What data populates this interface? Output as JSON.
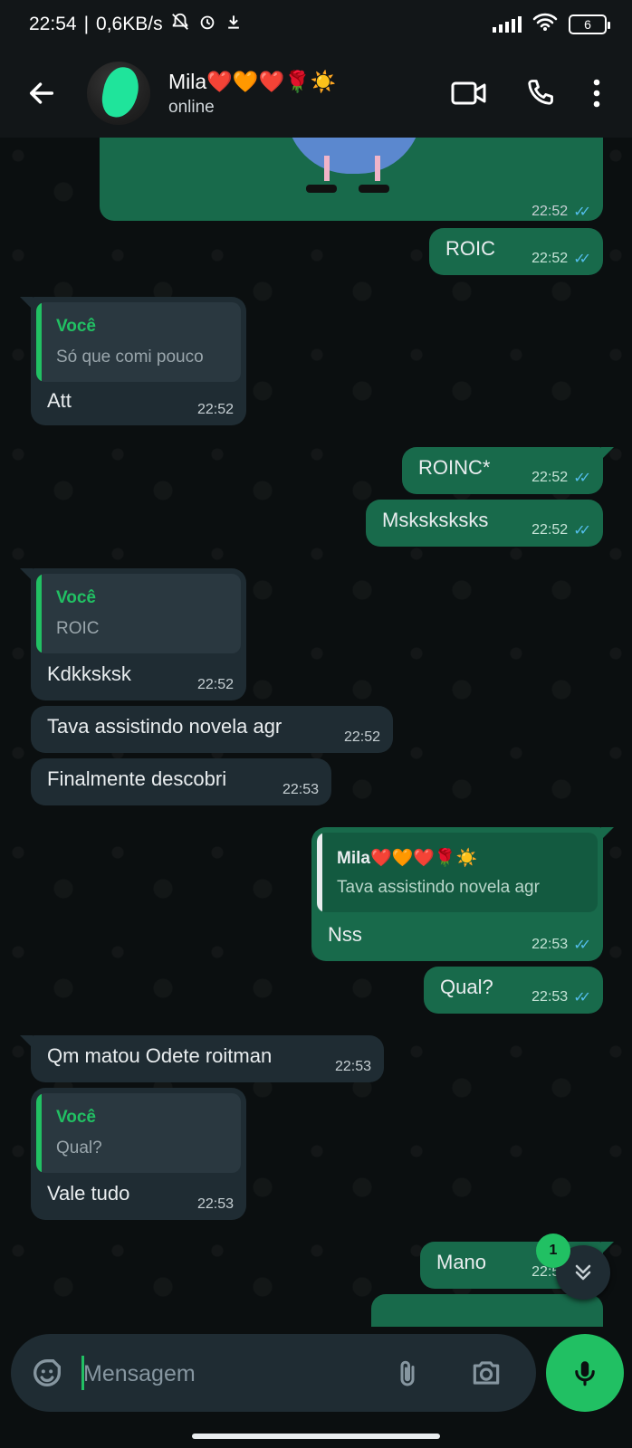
{
  "status_bar": {
    "time": "22:54",
    "net_speed": "0,6KB/s",
    "battery": "6"
  },
  "header": {
    "contact_name": "Mila❤️🧡❤️🌹☀️",
    "contact_status": "online"
  },
  "messages": [
    {
      "dir": "out",
      "text": "ROIC",
      "time": "22:52"
    },
    {
      "dir": "in",
      "quote_author": "Você",
      "quote_text": "Só que comi pouco",
      "text": "Att",
      "time": "22:52"
    },
    {
      "dir": "out",
      "text": "ROINC*",
      "time": "22:52"
    },
    {
      "dir": "out",
      "text": "Msksksksks",
      "time": "22:52"
    },
    {
      "dir": "in",
      "quote_author": "Você",
      "quote_text": "ROIC",
      "text": "Kdkksksk",
      "time": "22:52"
    },
    {
      "dir": "in",
      "text": "Tava assistindo novela agr",
      "time": "22:52"
    },
    {
      "dir": "in",
      "text": "Finalmente descobri",
      "time": "22:53"
    },
    {
      "dir": "out",
      "quote_author": "Mila❤️🧡❤️🌹☀️",
      "quote_text": "Tava assistindo novela agr",
      "text": "Nss",
      "time": "22:53"
    },
    {
      "dir": "out",
      "text": "Qual?",
      "time": "22:53"
    },
    {
      "dir": "in",
      "text": "Qm matou Odete roitman",
      "time": "22:53"
    },
    {
      "dir": "in",
      "quote_author": "Você",
      "quote_text": "Qual?",
      "text": "Vale tudo",
      "time": "22:53"
    },
    {
      "dir": "out",
      "text": "Mano",
      "time": "22:54"
    }
  ],
  "sticker_time": "22:52",
  "unread_count": "1",
  "input": {
    "placeholder": "Mensagem"
  },
  "colors": {
    "incoming_bubble": "#1f2c33",
    "outgoing_bubble": "#186a4b",
    "accent": "#21c063",
    "read_ticks": "#53bdeb"
  }
}
